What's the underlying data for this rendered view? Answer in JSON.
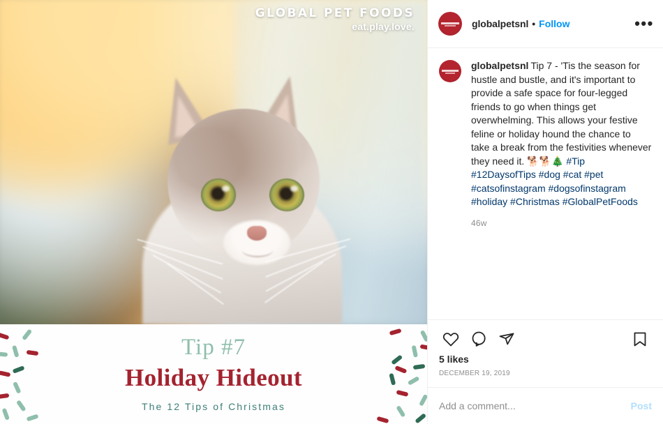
{
  "post": {
    "media": {
      "watermark": {
        "brand": "GLOBAL PET FOODS",
        "tagline": "eat.play.love."
      },
      "card": {
        "tip_number": "Tip #7",
        "tip_title": "Holiday Hideout",
        "series": "The 12 Tips of Christmas",
        "colors": {
          "tip_number": "#8fbfac",
          "tip_title": "#a4232f",
          "series": "#3f7f78",
          "confetti_red": "#a4232f",
          "confetti_green": "#8fbfac",
          "confetti_dark_green": "#2f6b55"
        }
      },
      "alt": "Tabby and white cat in front of a bokeh Christmas tree by a window"
    },
    "header": {
      "avatar_name": "globalpetsnl-avatar",
      "username": "globalpetsnl",
      "separator": "•",
      "follow_label": "Follow",
      "more_label": "•••",
      "follow_color": "#0095f6"
    },
    "caption": {
      "username": "globalpetsnl",
      "body": "Tip 7 - 'Tis the season for hustle and bustle, and it's important to provide a safe space for four-legged friends to go when things get overwhelming. This allows your festive feline or holiday hound the chance to take a break from the festivities whenever they need it. 🐕🐕🎄 ",
      "hashtags": "#Tip #12DaysofTips #dog #cat #pet #catsofinstagram #dogsofinstagram #holiday #Christmas #GlobalPetFoods",
      "hashtag_color": "#00376b",
      "time_ago": "46w"
    },
    "actions": {
      "like_icon": "heart-icon",
      "comment_icon": "comment-icon",
      "share_icon": "share-icon",
      "save_icon": "bookmark-icon",
      "likes": "5 likes",
      "posted_date": "DECEMBER 19, 2019"
    },
    "comment_box": {
      "placeholder": "Add a comment...",
      "post_label": "Post",
      "post_color": "#b2dffc"
    }
  }
}
